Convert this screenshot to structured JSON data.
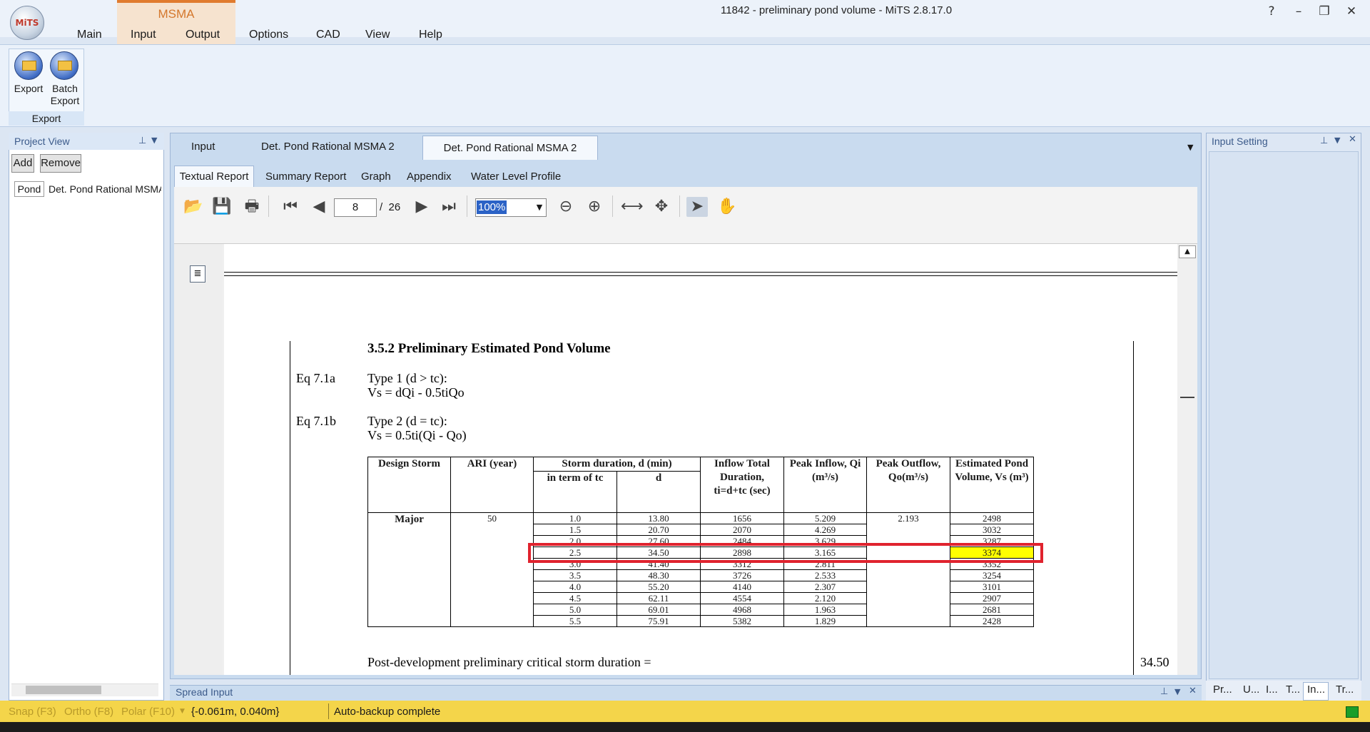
{
  "window": {
    "title": "11842 - preliminary pond volume - MiTS 2.8.17.0",
    "help": "?",
    "minimize": "–",
    "restore": "❐",
    "close": "✕",
    "logo_text": "MiTS"
  },
  "menu": {
    "context_group": "MSMA",
    "items": [
      "Main",
      "Input",
      "Output",
      "Options",
      "CAD",
      "View",
      "Help"
    ]
  },
  "ribbon": {
    "group_label": "Export",
    "buttons": [
      {
        "label": "Export",
        "icon": "export-icon"
      },
      {
        "label": "Batch Export",
        "label_line1": "Batch",
        "label_line2": "Export",
        "icon": "batch-export-icon"
      }
    ]
  },
  "project_view": {
    "title": "Project View",
    "add": "Add",
    "remove": "Remove",
    "item_type": "Pond",
    "item_name": "Det. Pond Rational MSMA 2"
  },
  "doc_tabs": {
    "tabs": [
      "Input",
      "Det. Pond Rational MSMA 2",
      "Det. Pond Rational MSMA 2"
    ],
    "active": 2
  },
  "report_tabs": {
    "tabs": [
      "Textual Report",
      "Summary Report",
      "Graph",
      "Appendix",
      "Water Level Profile"
    ],
    "active": 0
  },
  "toolbar": {
    "page": "8",
    "page_separator": "/",
    "page_total": "26",
    "zoom": "100%"
  },
  "report": {
    "section_title": "3.5.2 Preliminary Estimated Pond Volume",
    "eq1_label": "Eq 7.1a",
    "eq1_type": "Type 1 (d > tc):",
    "eq1_formula": "Vs = dQi - 0.5tiQo",
    "eq2_label": "Eq 7.1b",
    "eq2_type": "Type 2 (d = tc):",
    "eq2_formula": "Vs = 0.5ti(Qi - Qo)",
    "table": {
      "headers": {
        "design_storm": "Design Storm",
        "ari": "ARI (year)",
        "storm_duration": "Storm duration, d (min)",
        "in_term_of_tc": "in term of tc",
        "d": "d",
        "inflow_total": "Inflow Total Duration, ti=d+tc (sec)",
        "peak_inflow": "Peak Inflow, Qi (m³/s)",
        "peak_outflow": "Peak Outflow, Qo(m³/s)",
        "estimated_volume": "Estimated Pond Volume, Vs (m³)"
      },
      "design_storm": "Major",
      "ari": "50",
      "peak_outflow": "2.193",
      "rows": [
        {
          "tc": "1.0",
          "d": "13.80",
          "ti": "1656",
          "qi": "5.209",
          "vs": "2498"
        },
        {
          "tc": "1.5",
          "d": "20.70",
          "ti": "2070",
          "qi": "4.269",
          "vs": "3032"
        },
        {
          "tc": "2.0",
          "d": "27.60",
          "ti": "2484",
          "qi": "3.629",
          "vs": "3287"
        },
        {
          "tc": "2.5",
          "d": "34.50",
          "ti": "2898",
          "qi": "3.165",
          "vs": "3374"
        },
        {
          "tc": "3.0",
          "d": "41.40",
          "ti": "3312",
          "qi": "2.811",
          "vs": "3352"
        },
        {
          "tc": "3.5",
          "d": "48.30",
          "ti": "3726",
          "qi": "2.533",
          "vs": "3254"
        },
        {
          "tc": "4.0",
          "d": "55.20",
          "ti": "4140",
          "qi": "2.307",
          "vs": "3101"
        },
        {
          "tc": "4.5",
          "d": "62.11",
          "ti": "4554",
          "qi": "2.120",
          "vs": "2907"
        },
        {
          "tc": "5.0",
          "d": "69.01",
          "ti": "4968",
          "qi": "1.963",
          "vs": "2681"
        },
        {
          "tc": "5.5",
          "d": "75.91",
          "ti": "5382",
          "qi": "1.829",
          "vs": "2428"
        }
      ],
      "highlight_row": 3,
      "highlight_color": "#ffff00",
      "box_color": "#e0232e"
    },
    "critical_label": "Post-development preliminary critical storm duration =",
    "critical_value": "34.50"
  },
  "input_setting": {
    "title": "Input Setting"
  },
  "right_tabs": [
    "Pr...",
    "U...",
    "I...",
    "T...",
    "In...",
    "Tr..."
  ],
  "spread_input": {
    "title": "Spread Input"
  },
  "statusbar": {
    "snap": "Snap (F3)",
    "ortho": "Ortho (F8)",
    "polar": "Polar (F10)",
    "coords": "{-0.061m, 0.040m}",
    "message": "Auto-backup complete",
    "indicator_color": "#1a9e2a"
  },
  "colors": {
    "accent": "#e07b2e",
    "tab_blue": "#c9dbef",
    "status_bar": "#f4d54a"
  }
}
